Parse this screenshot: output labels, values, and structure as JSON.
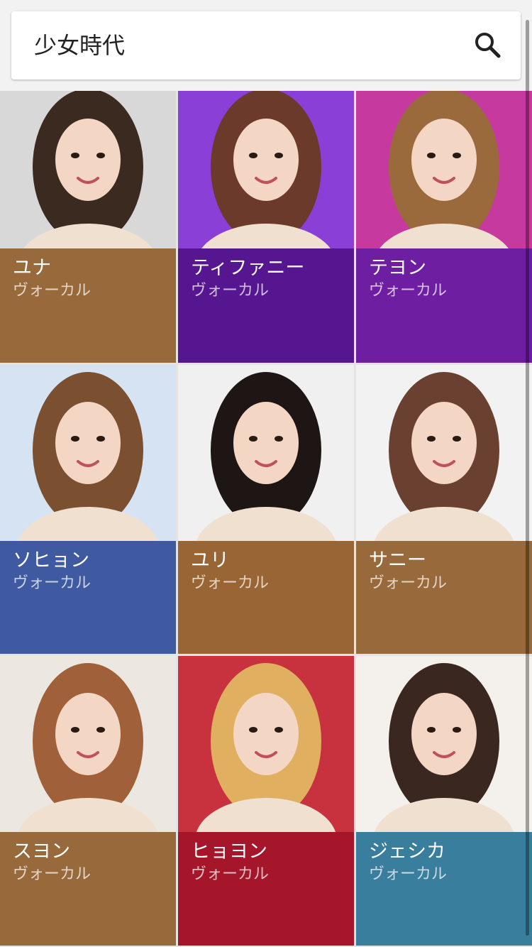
{
  "search": {
    "query": "少女時代",
    "icon": "search-icon"
  },
  "members": [
    {
      "name": "ユナ",
      "role": "ヴォーカル",
      "color": "#98693A",
      "photo_bg": "#d8d8d8",
      "hair": "#3a2a20"
    },
    {
      "name": "ティファニー",
      "role": "ヴォーカル",
      "color": "#55168F",
      "photo_bg": "#8a3fd6",
      "hair": "#6b3a2a"
    },
    {
      "name": "テヨン",
      "role": "ヴォーカル",
      "color": "#6E1FA1",
      "photo_bg": "#c63aa0",
      "hair": "#9a6a3c"
    },
    {
      "name": "ソヒョン",
      "role": "ヴォーカル",
      "color": "#3F5AA0",
      "photo_bg": "#d6e3f2",
      "hair": "#7a5030"
    },
    {
      "name": "ユリ",
      "role": "ヴォーカル",
      "color": "#9A6535",
      "photo_bg": "#f0f0f0",
      "hair": "#1e1614"
    },
    {
      "name": "サニー",
      "role": "ヴォーカル",
      "color": "#98693A",
      "photo_bg": "#f2f2f2",
      "hair": "#6a4030"
    },
    {
      "name": "スヨン",
      "role": "ヴォーカル",
      "color": "#98693A",
      "photo_bg": "#ece7e0",
      "hair": "#a0603a"
    },
    {
      "name": "ヒョヨン",
      "role": "ヴォーカル",
      "color": "#A5162A",
      "photo_bg": "#c8323e",
      "hair": "#e0b060"
    },
    {
      "name": "ジェシカ",
      "role": "ヴォーカル",
      "color": "#3A7E9D",
      "photo_bg": "#f4f1ec",
      "hair": "#3a2820"
    }
  ]
}
